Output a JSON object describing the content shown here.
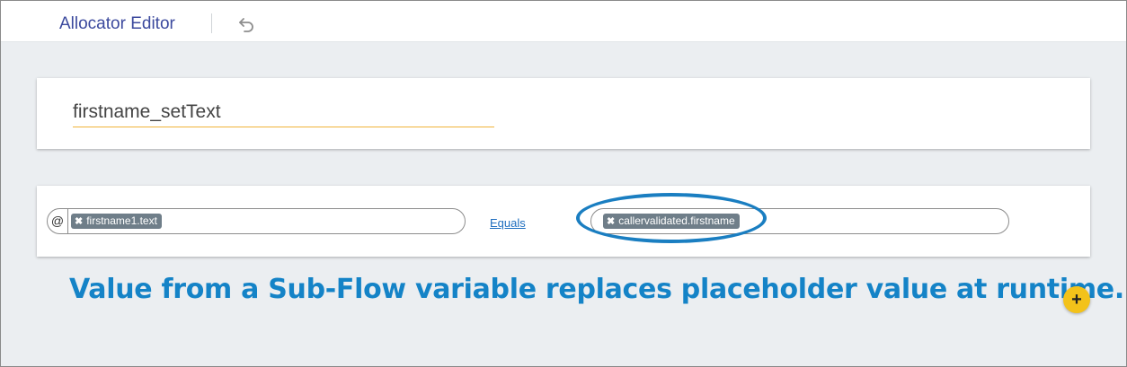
{
  "app": {
    "title": "Allocator Editor",
    "undo_icon": "undo-icon"
  },
  "name_card": {
    "value": "firstname_setText"
  },
  "condition": {
    "at_symbol": "@",
    "left_chip": {
      "remove": "✖",
      "label": "firstname1.text"
    },
    "operator": "Equals",
    "right_chip": {
      "remove": "✖",
      "label": "callervalidated.firstname"
    }
  },
  "annotation": {
    "text": "Value from a Sub-Flow variable replaces placeholder value at runtime."
  },
  "add_button": {
    "label": "+"
  },
  "colors": {
    "accent_underline": "#f0b43a",
    "highlight": "#1a7ec1",
    "annotation": "#1483c7",
    "add_button": "#f3c21a",
    "chip": "#6f7e89"
  }
}
